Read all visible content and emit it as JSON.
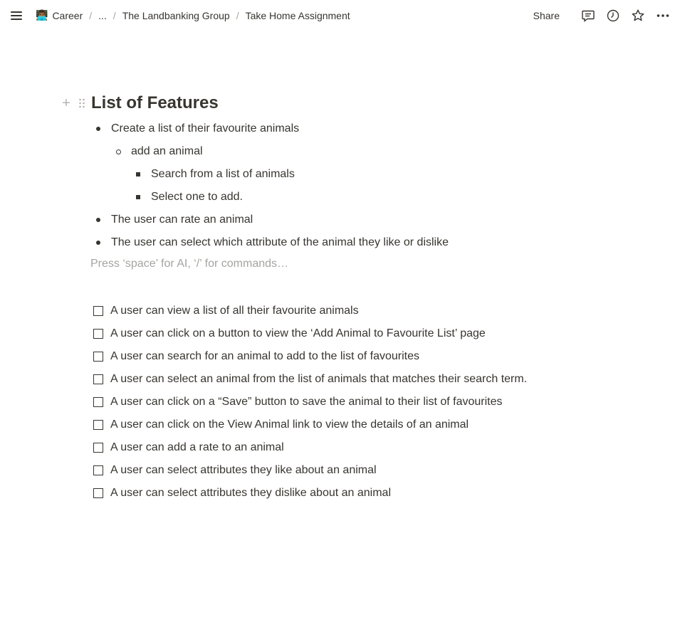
{
  "breadcrumb": {
    "emoji": "👨🏾‍💻",
    "items": [
      "Career",
      "...",
      "The Landbanking Group",
      "Take Home Assignment"
    ],
    "separator": "/"
  },
  "topbar": {
    "share_label": "Share",
    "icons": [
      "comment-icon",
      "history-icon",
      "star-icon",
      "more-icon"
    ]
  },
  "page": {
    "title": "List of Features",
    "bullets": [
      {
        "level": 0,
        "text": "Create a list of their favourite animals"
      },
      {
        "level": 1,
        "text": "add an animal"
      },
      {
        "level": 2,
        "text": "Search from a list of animals"
      },
      {
        "level": 2,
        "text": "Select one to add."
      },
      {
        "level": 0,
        "text": "The user can rate an animal"
      },
      {
        "level": 0,
        "text": "The user can select which attribute of the animal they like or dislike"
      }
    ],
    "placeholder": "Press ‘space’ for AI, ‘/’ for commands…",
    "todos": [
      {
        "text": "A user can view a list of all their favourite animals",
        "checked": false
      },
      {
        "text": "A user can click on a button to view the ‘Add Animal to Favourite List’ page",
        "checked": false
      },
      {
        "text": "A user can search for an animal to add to the list of favourites",
        "checked": false
      },
      {
        "text": "A user can select an animal from the list of animals that matches their search term.",
        "checked": false
      },
      {
        "text": "A user can click on a “Save” button to save the animal to their list of favourites",
        "checked": false
      },
      {
        "text": "A user can click on the View Animal link to view the details of an animal",
        "checked": false
      },
      {
        "text": "A user can add a rate to an animal",
        "checked": false
      },
      {
        "text": "A user can select attributes they like about an animal",
        "checked": false
      },
      {
        "text": "A user can select attributes they dislike about an animal",
        "checked": false
      }
    ]
  }
}
